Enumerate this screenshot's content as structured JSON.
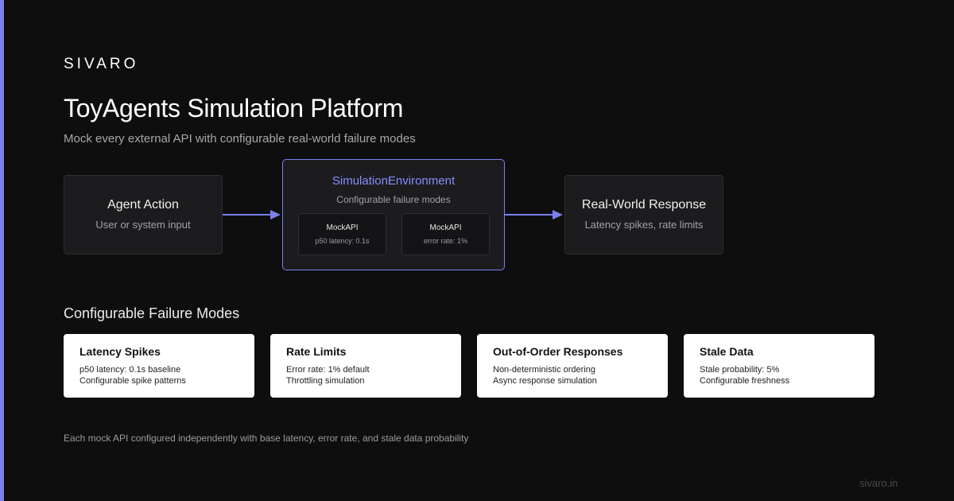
{
  "brand": "SIVARO",
  "title": "ToyAgents Simulation Platform",
  "subtitle": "Mock every external API with configurable real-world failure modes",
  "diagram": {
    "agent_box": {
      "title": "Agent Action",
      "subtitle": "User or system input"
    },
    "simulation_box": {
      "title": "SimulationEnvironment",
      "subtitle": "Configurable failure modes",
      "mocks": [
        {
          "name": "MockAPI",
          "detail": "p50 latency: 0.1s"
        },
        {
          "name": "MockAPI",
          "detail": "error rate: 1%"
        }
      ]
    },
    "response_box": {
      "title": "Real-World Response",
      "subtitle": "Latency spikes, rate limits"
    }
  },
  "failure_modes": {
    "heading": "Configurable Failure Modes",
    "cards": [
      {
        "title": "Latency Spikes",
        "lines": [
          "p50 latency: 0.1s baseline",
          "Configurable spike patterns"
        ]
      },
      {
        "title": "Rate Limits",
        "lines": [
          "Error rate: 1% default",
          "Throttling simulation"
        ]
      },
      {
        "title": "Out-of-Order Responses",
        "lines": [
          "Non-deterministic ordering",
          "Async response simulation"
        ]
      },
      {
        "title": "Stale Data",
        "lines": [
          "Stale probability: 5%",
          "Configurable freshness"
        ]
      }
    ]
  },
  "footnote": "Each mock API configured independently with base latency, error rate, and stale data probability",
  "footer_url": "sivaro.in",
  "colors": {
    "background": "#0e0e0e",
    "accent": "#7b7ff0",
    "box_fill": "#1c1c1e",
    "card_fill": "#ffffff"
  }
}
